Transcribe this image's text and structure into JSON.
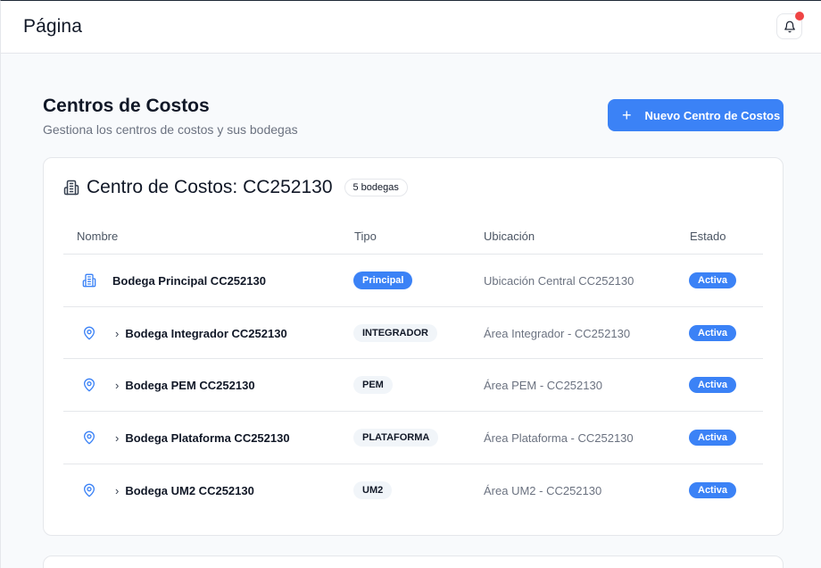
{
  "topbar": {
    "title": "Página",
    "bell_icon": "bell-icon",
    "notification_color": "#ef4444"
  },
  "header": {
    "title": "Centros de Costos",
    "subtitle": "Gestiona los centros de costos y sus bodegas",
    "new_button": {
      "icon": "plus-icon",
      "label": "Nuevo Centro de Costos"
    }
  },
  "cost_center": {
    "icon": "building-icon",
    "title": "Centro de Costos: CC252130",
    "count_badge": "5 bodegas",
    "columns": [
      "Nombre",
      "Tipo",
      "Ubicación",
      "Estado"
    ],
    "rows": [
      {
        "icon": "building-icon",
        "chevron": "",
        "name": "Bodega Principal CC252130",
        "type": "Principal",
        "location": "Ubicación Central CC252130",
        "status": "Activa"
      },
      {
        "icon": "map-pin-icon",
        "chevron": "›",
        "name": "Bodega Integrador CC252130",
        "type": "INTEGRADOR",
        "location": "Área Integrador - CC252130",
        "status": "Activa"
      },
      {
        "icon": "map-pin-icon",
        "chevron": "›",
        "name": "Bodega PEM CC252130",
        "type": "PEM",
        "location": "Área PEM - CC252130",
        "status": "Activa"
      },
      {
        "icon": "map-pin-icon",
        "chevron": "›",
        "name": "Bodega Plataforma CC252130",
        "type": "PLATAFORMA",
        "location": "Área Plataforma - CC252130",
        "status": "Activa"
      },
      {
        "icon": "map-pin-icon",
        "chevron": "›",
        "name": "Bodega UM2 CC252130",
        "type": "UM2",
        "location": "Área UM2 - CC252130",
        "status": "Activa"
      }
    ]
  },
  "colors": {
    "accent": "#3b82f6",
    "badge_neutral": "#f1f5f9",
    "border": "#e5e7eb"
  }
}
